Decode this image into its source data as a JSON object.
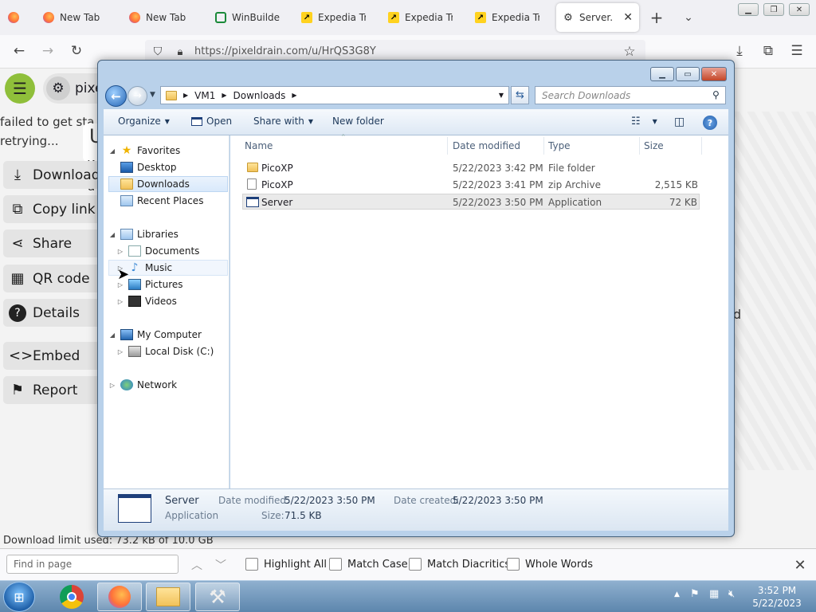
{
  "browser": {
    "tabs": [
      {
        "label": "",
        "icon": "firefox-icon"
      },
      {
        "label": "New Tab",
        "icon": "firefox-icon"
      },
      {
        "label": "New Tab",
        "icon": "firefox-icon"
      },
      {
        "label": "WinBuilder",
        "icon": "winbuilder-icon"
      },
      {
        "label": "Expedia Trav",
        "icon": "expedia-icon"
      },
      {
        "label": "Expedia Trav",
        "icon": "expedia-icon"
      },
      {
        "label": "Expedia Trav",
        "icon": "expedia-icon"
      },
      {
        "label": "Server.exe",
        "icon": "pixeldrain-icon",
        "active": true
      }
    ],
    "url": "https://pixeldrain.com/u/HrQS3G8Y"
  },
  "page": {
    "brand": "pixel",
    "status_line1": "failed to get sta",
    "status_line2": "retrying...",
    "buttons": [
      "Download",
      "Copy link",
      "Share",
      "QR code",
      "Details",
      "Embed",
      "Report"
    ],
    "download_limit": "Download limit used: 73.2 kB of 10.0 GB",
    "partial_u": "U",
    "partial_w": "W",
    "partial_a": "a",
    "partial_d": "d"
  },
  "explorer": {
    "breadcrumb": [
      "VM1",
      "Downloads"
    ],
    "search_placeholder": "Search Downloads",
    "toolbar": {
      "organize": "Organize",
      "open": "Open",
      "share_with": "Share with",
      "new_folder": "New folder"
    },
    "nav": {
      "favorites": "Favorites",
      "desktop": "Desktop",
      "downloads": "Downloads",
      "recent_places": "Recent Places",
      "libraries": "Libraries",
      "documents": "Documents",
      "music": "Music",
      "pictures": "Pictures",
      "videos": "Videos",
      "my_computer": "My Computer",
      "local_disk": "Local Disk (C:)",
      "network": "Network"
    },
    "columns": {
      "name": "Name",
      "date_modified": "Date modified",
      "type": "Type",
      "size": "Size"
    },
    "files": [
      {
        "name": "PicoXP",
        "date": "5/22/2023 3:42 PM",
        "type": "File folder",
        "size": ""
      },
      {
        "name": "PicoXP",
        "date": "5/22/2023 3:41 PM",
        "type": "zip Archive",
        "size": "2,515 KB"
      },
      {
        "name": "Server",
        "date": "5/22/2023 3:50 PM",
        "type": "Application",
        "size": "72 KB"
      }
    ],
    "details": {
      "name": "Server",
      "type": "Application",
      "date_modified_label": "Date modified:",
      "date_modified": "5/22/2023 3:50 PM",
      "size_label": "Size:",
      "size": "71.5 KB",
      "date_created_label": "Date created:",
      "date_created": "5/22/2023 3:50 PM"
    }
  },
  "findbar": {
    "placeholder": "Find in page",
    "highlight_all": "Highlight All",
    "match_case": "Match Case",
    "match_diacritics": "Match Diacritics",
    "whole_words": "Whole Words"
  },
  "taskbar": {
    "time": "3:52 PM",
    "date": "5/22/2023"
  }
}
